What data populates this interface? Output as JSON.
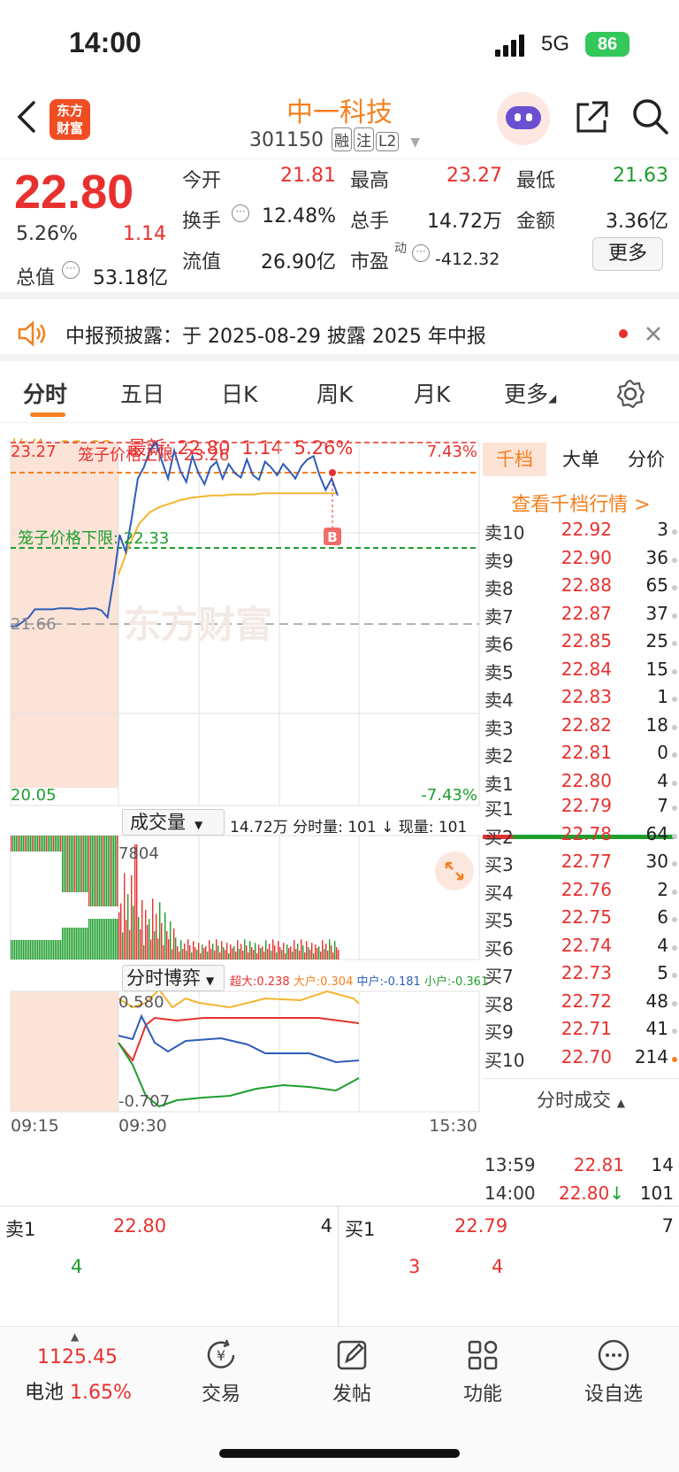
{
  "status_bar": {
    "time": "14:00",
    "network": "5G",
    "battery": "86"
  },
  "nav": {
    "logo_line1": "东方",
    "logo_line2": "财富",
    "stock_name": "中一科技",
    "stock_code": "301150",
    "tags": [
      "融",
      "注",
      "L2"
    ]
  },
  "quote": {
    "price": "22.80",
    "change_pct": "5.26%",
    "change": "1.14",
    "open_label": "今开",
    "open": "21.81",
    "high_label": "最高",
    "high": "23.27",
    "low_label": "最低",
    "low": "21.63",
    "turnover_label": "换手",
    "turnover": "12.48%",
    "volume_label": "总手",
    "volume": "14.72万",
    "amount_label": "金额",
    "amount": "3.36亿",
    "mktcap_label": "总值",
    "mktcap": "53.18亿",
    "float_label": "流值",
    "float_cap": "26.90亿",
    "pe_label": "市盈",
    "pe_sup": "动",
    "pe": "-412.32",
    "more_label": "更多"
  },
  "notice": {
    "text": "中报预披露：于 2025-08-29 披露 2025 年中报"
  },
  "tabs": [
    {
      "label": "分时"
    },
    {
      "label": "五日"
    },
    {
      "label": "日K"
    },
    {
      "label": "周K"
    },
    {
      "label": "月K"
    },
    {
      "label": "更多"
    }
  ],
  "chart_header": {
    "avg_label": "均价:",
    "avg": "22.82",
    "latest_label": "最新:",
    "latest": "22.80",
    "change": "1.14",
    "change_pct": "5.26%"
  },
  "price_chart": {
    "top": "23.27",
    "top_pct": "7.43%",
    "bottom": "20.05",
    "bottom_pct": "-7.43%",
    "prev_close": "21.66",
    "upper_limit_label": "笼子价格上限: 23.26",
    "lower_limit_label": "笼子价格下限: 22.33",
    "watermark": "东方财富",
    "marker": "B"
  },
  "volume_panel": {
    "select": "成交量",
    "total": "14.72万",
    "minute_vol": "分时量: 101",
    "arrow": "↓",
    "cur_vol": "现量: 101",
    "max": "7804"
  },
  "game_panel": {
    "select": "分时博弈",
    "xl": "超大:0.238",
    "l": "大户:0.304",
    "m": "中户:-0.181",
    "s": "小户:-0.361",
    "top": "0.580",
    "bottom": "-0.707"
  },
  "time_axis": [
    "09:15",
    "09:30",
    "15:30"
  ],
  "orderbook": {
    "tabs": [
      "千档",
      "大单",
      "分价"
    ],
    "link": "查看千档行情 >",
    "asks": [
      {
        "l": "卖10",
        "p": "22.92",
        "v": "3"
      },
      {
        "l": "卖9",
        "p": "22.90",
        "v": "36"
      },
      {
        "l": "卖8",
        "p": "22.88",
        "v": "65"
      },
      {
        "l": "卖7",
        "p": "22.87",
        "v": "37"
      },
      {
        "l": "卖6",
        "p": "22.85",
        "v": "25"
      },
      {
        "l": "卖5",
        "p": "22.84",
        "v": "15"
      },
      {
        "l": "卖4",
        "p": "22.83",
        "v": "1"
      },
      {
        "l": "卖3",
        "p": "22.82",
        "v": "18"
      },
      {
        "l": "卖2",
        "p": "22.81",
        "v": "0"
      },
      {
        "l": "卖1",
        "p": "22.80",
        "v": "4"
      }
    ],
    "bids": [
      {
        "l": "买1",
        "p": "22.79",
        "v": "7"
      },
      {
        "l": "买2",
        "p": "22.78",
        "v": "64"
      },
      {
        "l": "买3",
        "p": "22.77",
        "v": "30"
      },
      {
        "l": "买4",
        "p": "22.76",
        "v": "2"
      },
      {
        "l": "买5",
        "p": "22.75",
        "v": "6"
      },
      {
        "l": "买6",
        "p": "22.74",
        "v": "4"
      },
      {
        "l": "买7",
        "p": "22.73",
        "v": "5"
      },
      {
        "l": "买8",
        "p": "22.72",
        "v": "48"
      },
      {
        "l": "买9",
        "p": "22.71",
        "v": "41"
      },
      {
        "l": "买10",
        "p": "22.70",
        "v": "214"
      }
    ],
    "ticks_header": "分时成交",
    "ticks": [
      {
        "t": "13:59",
        "p": "22.81",
        "v": "14"
      },
      {
        "t": "14:00",
        "p": "22.80",
        "v": "101",
        "arrow": "↓"
      }
    ]
  },
  "tape": {
    "ask_label": "卖1",
    "ask_price": "22.80",
    "ask_vol": "4",
    "ask_queue": [
      "4"
    ],
    "bid_label": "买1",
    "bid_price": "22.79",
    "bid_vol": "7",
    "bid_queue": [
      "3",
      "4"
    ]
  },
  "bottom": {
    "index_value": "1125.45",
    "index_name": "电池",
    "index_pct": "1.65%",
    "trade": "交易",
    "post": "发帖",
    "func": "功能",
    "watch": "设自选"
  },
  "chart_data": {
    "type": "line",
    "title": "",
    "x_range": [
      "09:15",
      "15:30"
    ],
    "ylim": [
      20.05,
      23.27
    ],
    "prev_close": 21.66,
    "series": [
      {
        "values": [
          21.64,
          21.64,
          21.68,
          21.72,
          21.79,
          21.79,
          21.79,
          21.79,
          21.8,
          21.8,
          21.8,
          21.79,
          21.79,
          21.8,
          21.8,
          21.78,
          21.72,
          22.05,
          22.45,
          22.3,
          22.6,
          22.95,
          23.05,
          23.2,
          23.27,
          23.1,
          22.95,
          23.2,
          23.02,
          22.92,
          23.15,
          23,
          22.9,
          23.05,
          23.1,
          22.95,
          23.08,
          23,
          22.96,
          23.12,
          22.98,
          22.94,
          23.1,
          23.05,
          22.98,
          23.08,
          23.02,
          22.95,
          23.06,
          23.12,
          23.15,
          22.98,
          22.85,
          22.95,
          22.8
        ]
      },
      {
        "values": [
          22.1,
          22.35,
          22.55,
          22.65,
          22.7,
          22.73,
          22.76,
          22.78,
          22.79,
          22.8,
          22.8,
          22.81,
          22.81,
          22.81,
          22.82,
          22.82,
          22.82,
          22.82,
          22.82,
          22.82,
          22.82,
          22.82
        ]
      }
    ]
  },
  "colors": {
    "brand": "#f5801f",
    "up": "#e8312f",
    "down": "#1e9e2c",
    "avg_line": "#f4b630",
    "price_line": "#2e5cb8"
  }
}
